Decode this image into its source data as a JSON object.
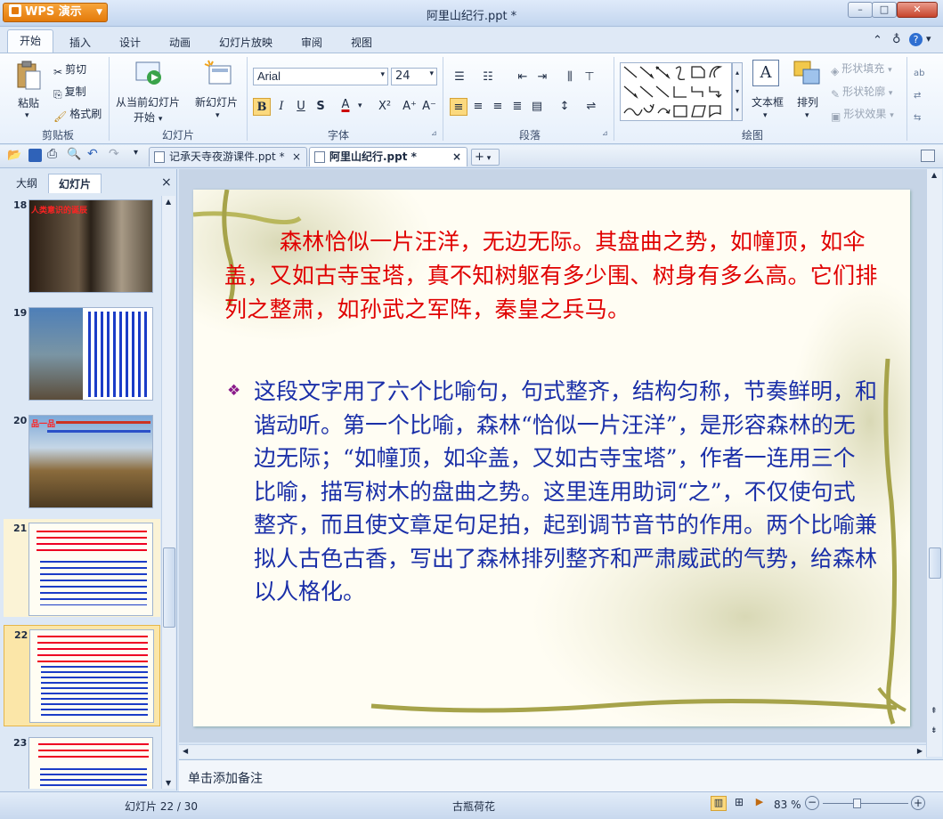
{
  "app": {
    "badge": "WPS 演示",
    "doc_title": "阿里山纪行.ppt *"
  },
  "window": {
    "minimize": "–",
    "maximize": "□",
    "close": "✕"
  },
  "ribbon_tabs": [
    "开始",
    "插入",
    "设计",
    "动画",
    "幻灯片放映",
    "审阅",
    "视图"
  ],
  "ribbon": {
    "clipboard": {
      "paste": "粘贴",
      "cut": "剪切",
      "copy": "复制",
      "format_painter": "格式刷",
      "label": "剪贴板"
    },
    "slides": {
      "from_current_1": "从当前幻灯片",
      "from_current_2": "开始",
      "new_slide": "新幻灯片",
      "label": "幻灯片"
    },
    "font": {
      "name": "Arial",
      "size": "24",
      "bold": "B",
      "italic": "I",
      "underline": "U",
      "shadow": "S",
      "color": "A",
      "superscript": "X²",
      "grow": "A⁺",
      "shrink": "A⁻",
      "label": "字体"
    },
    "paragraph": {
      "label": "段落"
    },
    "drawing": {
      "textbox": "文本框",
      "arrange": "排列",
      "shape_fill": "形状填充",
      "shape_outline": "形状轮廓",
      "shape_effect": "形状效果",
      "label": "绘图"
    }
  },
  "doc_tabs": [
    {
      "label": "记承天寺夜游课件.ppt *",
      "close": "×"
    },
    {
      "label": "阿里山纪行.ppt *",
      "close": "×"
    }
  ],
  "left_panel": {
    "tab_outline": "大纲",
    "tab_slides": "幻灯片",
    "close": "×"
  },
  "thumbnails": [
    {
      "num": "18",
      "title": "人类意识的诞辰"
    },
    {
      "num": "19"
    },
    {
      "num": "20",
      "title": "品一品"
    },
    {
      "num": "21"
    },
    {
      "num": "22"
    },
    {
      "num": "23"
    }
  ],
  "slide": {
    "red_text": "森林恰似一片汪洋，无边无际。其盘曲之势，如幢顶，如伞盖，又如古寺宝塔，真不知树躯有多少围、树身有多么高。它们排列之整肃，如孙武之军阵，秦皇之兵马。",
    "bullet": "❖",
    "blue_text": "这段文字用了六个比喻句，句式整齐，结构匀称，节奏鲜明，和谐动听。第一个比喻，森林“恰似一片汪洋”，是形容森林的无边无际；“如幢顶，如伞盖，又如古寺宝塔”，作者一连用三个比喻，描写树木的盘曲之势。这里连用助词“之”，不仅使句式整齐，而且使文章足句足拍，起到调节音节的作用。两个比喻兼拟人古色古香，写出了森林排列整齐和严肃威武的气势，给森林以人格化。"
  },
  "notes": {
    "placeholder": "单击添加备注"
  },
  "status": {
    "slide_counter": "幻灯片 22 / 30",
    "theme": "古瓶荷花",
    "zoom": "83 %"
  }
}
